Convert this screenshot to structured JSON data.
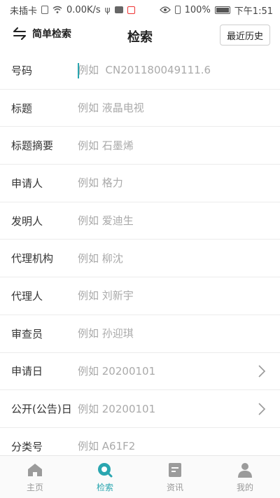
{
  "status_bar": {
    "carrier": "未插卡",
    "speed": "0.00K/s",
    "battery": "100%",
    "time": "下午1:51"
  },
  "header": {
    "simple_search_label": "简单检索",
    "title": "检索",
    "history_label": "最近历史"
  },
  "fields": [
    {
      "label": "号码",
      "placeholder": "例如  CN201180049111.6"
    },
    {
      "label": "标题",
      "placeholder": "例如 液晶电视"
    },
    {
      "label": "标题摘要",
      "placeholder": "例如 石墨烯"
    },
    {
      "label": "申请人",
      "placeholder": "例如 格力"
    },
    {
      "label": "发明人",
      "placeholder": "例如 爱迪生"
    },
    {
      "label": "代理机构",
      "placeholder": "例如 柳沈"
    },
    {
      "label": "代理人",
      "placeholder": "例如 刘新宇"
    },
    {
      "label": "审查员",
      "placeholder": "例如 孙迎琪"
    },
    {
      "label": "申请日",
      "placeholder": "例如 20200101"
    },
    {
      "label": "公开(公告)日",
      "placeholder": "例如 20200101"
    },
    {
      "label": "分类号",
      "placeholder": "例如 A61F2"
    }
  ],
  "tabs": [
    {
      "label": "主页"
    },
    {
      "label": "检索"
    },
    {
      "label": "资讯"
    },
    {
      "label": "我的"
    }
  ],
  "colors": {
    "accent": "#2aa6b0",
    "inactive": "#999999"
  }
}
